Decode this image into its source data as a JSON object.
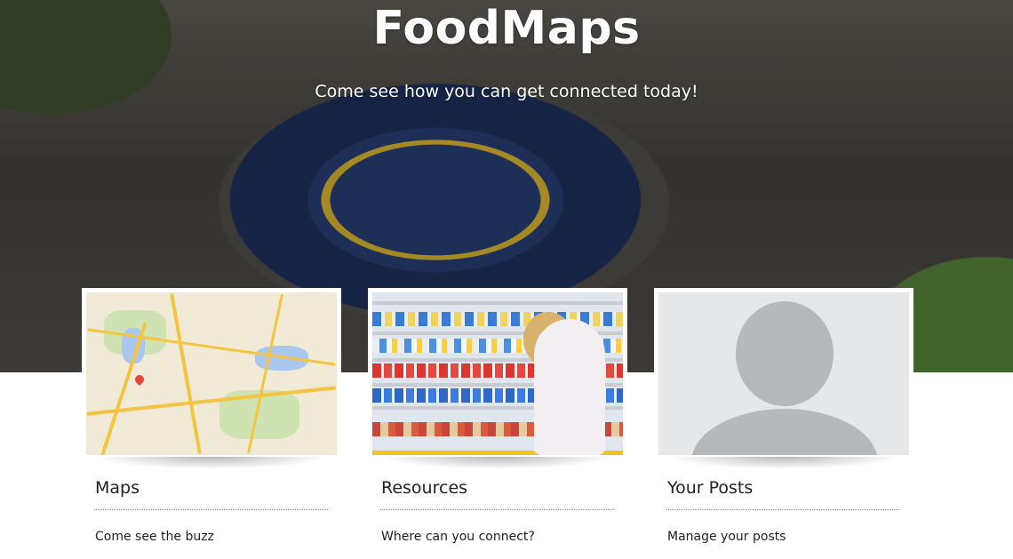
{
  "hero": {
    "title": "FoodMaps",
    "subtitle": "Come see how you can get connected today!"
  },
  "cards": [
    {
      "title": "Maps",
      "description": "Come see the buzz",
      "image": "map-image"
    },
    {
      "title": "Resources",
      "description": "Where can you connect?",
      "image": "grocery-shelf-image"
    },
    {
      "title": "Your Posts",
      "description": "Manage your posts",
      "image": "avatar-placeholder-image"
    }
  ],
  "colors": {
    "hero_overlay": "#3f3d3a",
    "card_frame": "#ffffff",
    "text": "#222222",
    "avatar_bg": "#e6e7e8",
    "avatar_fg": "#b5b9bc"
  }
}
